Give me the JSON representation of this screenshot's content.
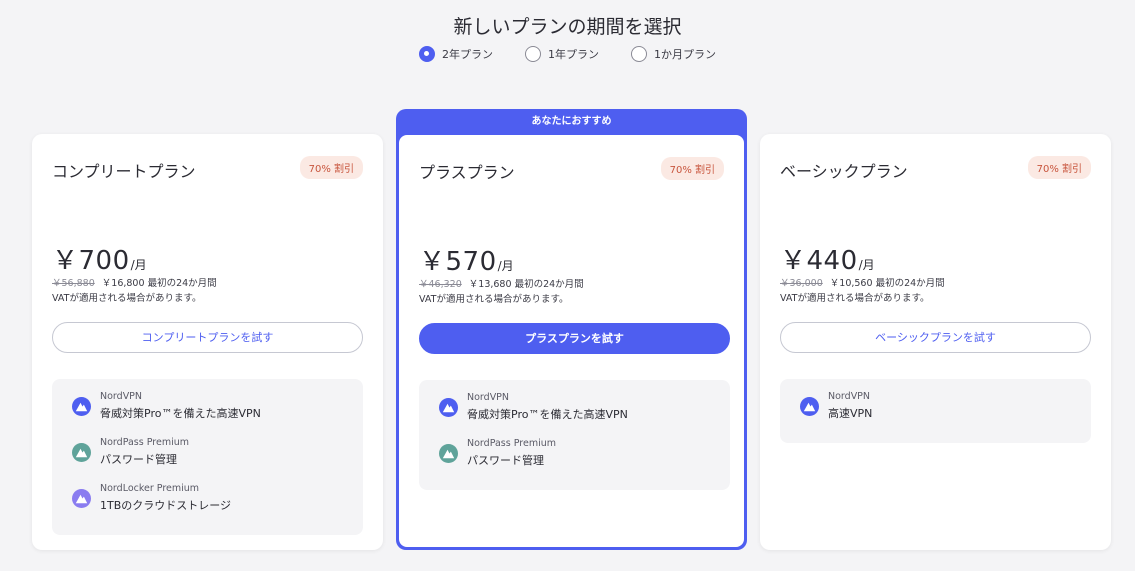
{
  "page_title": "新しいプランの期間を選択",
  "periods": [
    {
      "label": "2年プラン",
      "selected": true
    },
    {
      "label": "1年プラン",
      "selected": false
    },
    {
      "label": "1か月プラン",
      "selected": false
    }
  ],
  "recommended_label": "あなたにおすすめ",
  "plans": {
    "complete": {
      "name": "コンプリートプラン",
      "discount": "70% 割引",
      "price": "￥700",
      "per": "/月",
      "old_price": "￥56,880",
      "new_price": "￥16,800",
      "period_note": "最初の24か月間",
      "vat": "VATが適用される場合があります。",
      "cta": "コンプリートプランを試す",
      "features": [
        {
          "product": "NordVPN",
          "desc": "脅威対策Pro™を備えた高速VPN"
        },
        {
          "product": "NordPass Premium",
          "desc": "パスワード管理"
        },
        {
          "product": "NordLocker Premium",
          "desc": "1TBのクラウドストレージ"
        }
      ]
    },
    "plus": {
      "name": "プラスプラン",
      "discount": "70% 割引",
      "price": "￥570",
      "per": "/月",
      "old_price": "￥46,320",
      "new_price": "￥13,680",
      "period_note": "最初の24か月間",
      "vat": "VATが適用される場合があります。",
      "cta": "プラスプランを試す",
      "features": [
        {
          "product": "NordVPN",
          "desc": "脅威対策Pro™を備えた高速VPN"
        },
        {
          "product": "NordPass Premium",
          "desc": "パスワード管理"
        }
      ]
    },
    "basic": {
      "name": "ベーシックプラン",
      "discount": "70% 割引",
      "price": "￥440",
      "per": "/月",
      "old_price": "￥36,000",
      "new_price": "￥10,560",
      "period_note": "最初の24か月間",
      "vat": "VATが適用される場合があります。",
      "cta": "ベーシックプランを試す",
      "features": [
        {
          "product": "NordVPN",
          "desc": "高速VPN"
        }
      ]
    }
  },
  "colors": {
    "accent": "#4e5ef0",
    "badge_bg": "#fbe9e3",
    "badge_text": "#c8553d",
    "nordvpn_icon": "#4e5ef0",
    "nordpass_icon": "#5fa39a",
    "nordlocker_icon": "#8a7cf0"
  },
  "icons": {
    "nordvpn": "nordvpn-icon",
    "nordpass": "nordpass-icon",
    "nordlocker": "nordlocker-icon"
  }
}
